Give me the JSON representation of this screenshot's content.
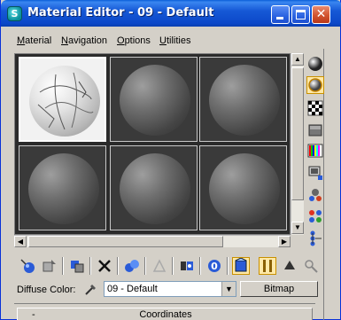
{
  "window": {
    "title": "Material Editor - 09 - Default",
    "app_icon_glyph": "S"
  },
  "menu": {
    "items": [
      "Material",
      "Navigation",
      "Options",
      "Utilities"
    ]
  },
  "sample_slots": {
    "active_index": 0,
    "count": 6
  },
  "right_toolbar": {
    "icons": [
      "sample-type-sphere-icon",
      "backlight-icon",
      "background-checker-icon",
      "sample-uv-tiling-icon",
      "video-color-check-icon",
      "make-preview-icon",
      "options-icon",
      "select-by-material-icon",
      "material-map-navigator-icon"
    ],
    "active_index": 1
  },
  "bottom_toolbar": {
    "icons": [
      "get-material-icon",
      "put-material-to-scene-icon",
      "assign-material-icon",
      "reset-map-icon",
      "make-unique-icon",
      "put-to-library-icon",
      "material-effects-channel-icon",
      "show-map-in-viewport-icon",
      "show-end-result-icon",
      "go-to-parent-icon",
      "go-forward-to-sibling-icon"
    ],
    "active_indices": [
      7,
      8
    ]
  },
  "diffuse": {
    "label": "Diffuse Color:",
    "material_value": "09 - Default",
    "bitmap_label": "Bitmap"
  },
  "rollout": {
    "toggle": "-",
    "title": "Coordinates"
  },
  "colors": {
    "title_bar": "#0b47c8",
    "active_tool": "#ffe9a8",
    "slot_background": "#2b2b2b"
  }
}
